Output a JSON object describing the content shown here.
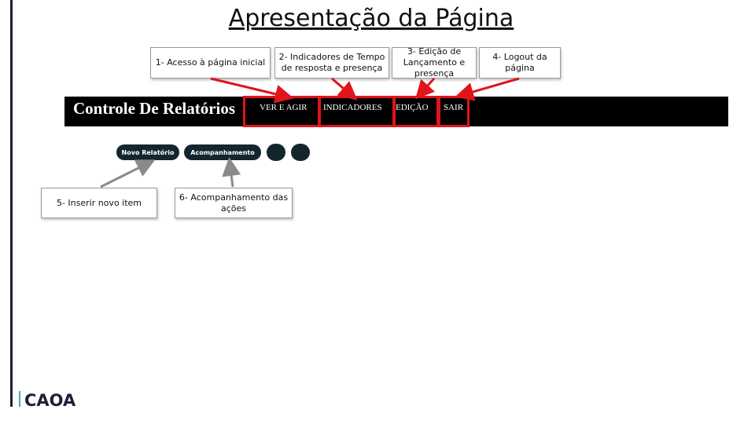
{
  "slide": {
    "title": "Apresentação da Página"
  },
  "callouts": {
    "c1": "1- Acesso à página inicial",
    "c2": "2- Indicadores de Tempo de resposta e presença",
    "c3": "3- Edição de Lançamento e presença",
    "c4": "4- Logout da página",
    "c5": "5- Inserir  novo item",
    "c6": "6- Acompanhamento das ações"
  },
  "app": {
    "brand": "Controle De Relatórios",
    "nav": [
      "VER E AGIR",
      "INDICADORES",
      "EDIÇÃO",
      "SAIR"
    ],
    "buttons": {
      "new_report": "Novo Relatório",
      "tracking": "Acompanhamento"
    }
  },
  "logo": {
    "text": "CAOA"
  },
  "colors": {
    "highlight": "#e0141b",
    "pill": "#13262e",
    "navbar": "#000000",
    "logo": "#1b1f3a",
    "logo_accent": "#3fb39b"
  }
}
